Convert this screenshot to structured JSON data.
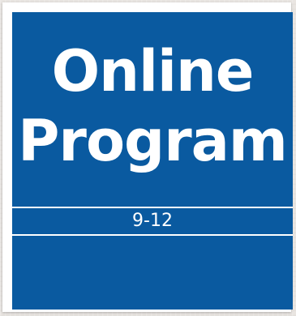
{
  "program_card": {
    "title_line_1": "Online",
    "title_line_2": "Program",
    "grade_range": "9-12",
    "colors": {
      "panel_background": "#0a5aa0",
      "text": "#ffffff",
      "frame": "#ffffff"
    }
  }
}
